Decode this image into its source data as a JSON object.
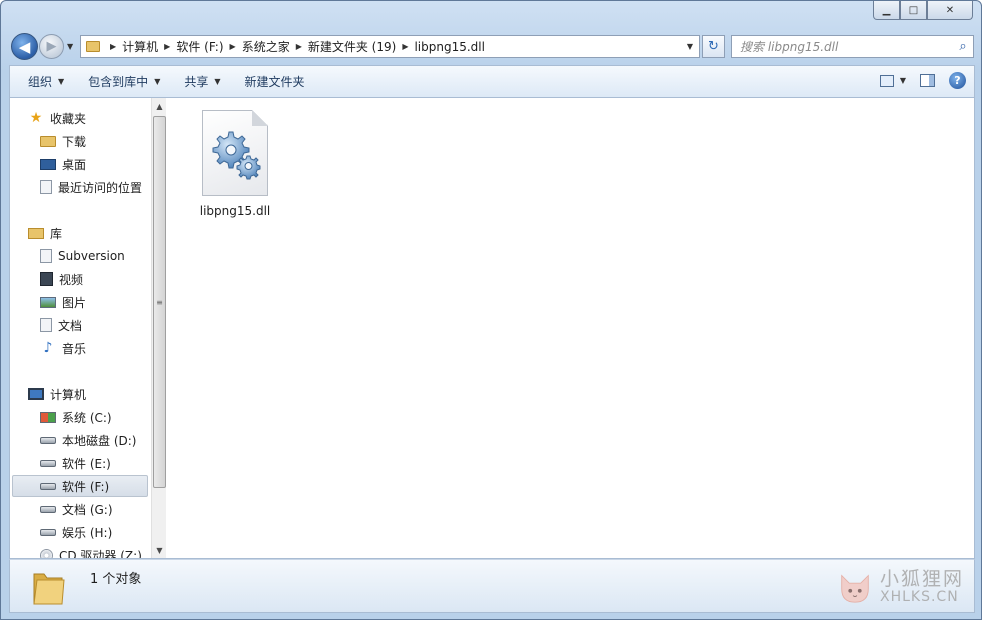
{
  "window": {
    "buttons": {
      "minimize": "▁",
      "maximize": "□",
      "close": "✕"
    }
  },
  "navigation": {
    "back_glyph": "◀",
    "forward_glyph": "▶",
    "dropdown_glyph": "▼"
  },
  "address": {
    "crumbs": [
      "计算机",
      "软件 (F:)",
      "系统之家",
      "新建文件夹 (19)",
      "libpng15.dll"
    ],
    "separator": "▶",
    "dropdown_glyph": "▼",
    "refresh_glyph": "↻"
  },
  "search": {
    "placeholder": "搜索 libpng15.dll",
    "icon_glyph": "⌕"
  },
  "toolbar": {
    "organize": "组织",
    "include_in_library": "包含到库中",
    "share": "共享",
    "new_folder": "新建文件夹",
    "caret": "▼",
    "help": "?"
  },
  "sidebar": {
    "favorites": {
      "label": "收藏夹",
      "items": [
        "下载",
        "桌面",
        "最近访问的位置"
      ]
    },
    "libraries": {
      "label": "库",
      "items": [
        "Subversion",
        "视频",
        "图片",
        "文档",
        "音乐"
      ]
    },
    "computer": {
      "label": "计算机",
      "items": [
        "系统 (C:)",
        "本地磁盘 (D:)",
        "软件 (E:)",
        "软件 (F:)",
        "文档 (G:)",
        "娱乐 (H:)",
        "CD 驱动器 (Z:)"
      ],
      "selected": "软件 (F:)"
    },
    "scroll": {
      "up": "▲",
      "down": "▼",
      "grip": "≡"
    }
  },
  "files": [
    {
      "name": "libpng15.dll",
      "icon": "dll-gear-icon"
    }
  ],
  "details": {
    "count_text": "1 个对象"
  },
  "watermark": {
    "cn": "小狐狸网",
    "en": "XHLKS.CN"
  },
  "colors": {
    "chrome": "#b9d1ea",
    "accent": "#2d5fa7",
    "folder": "#e8c46a"
  }
}
